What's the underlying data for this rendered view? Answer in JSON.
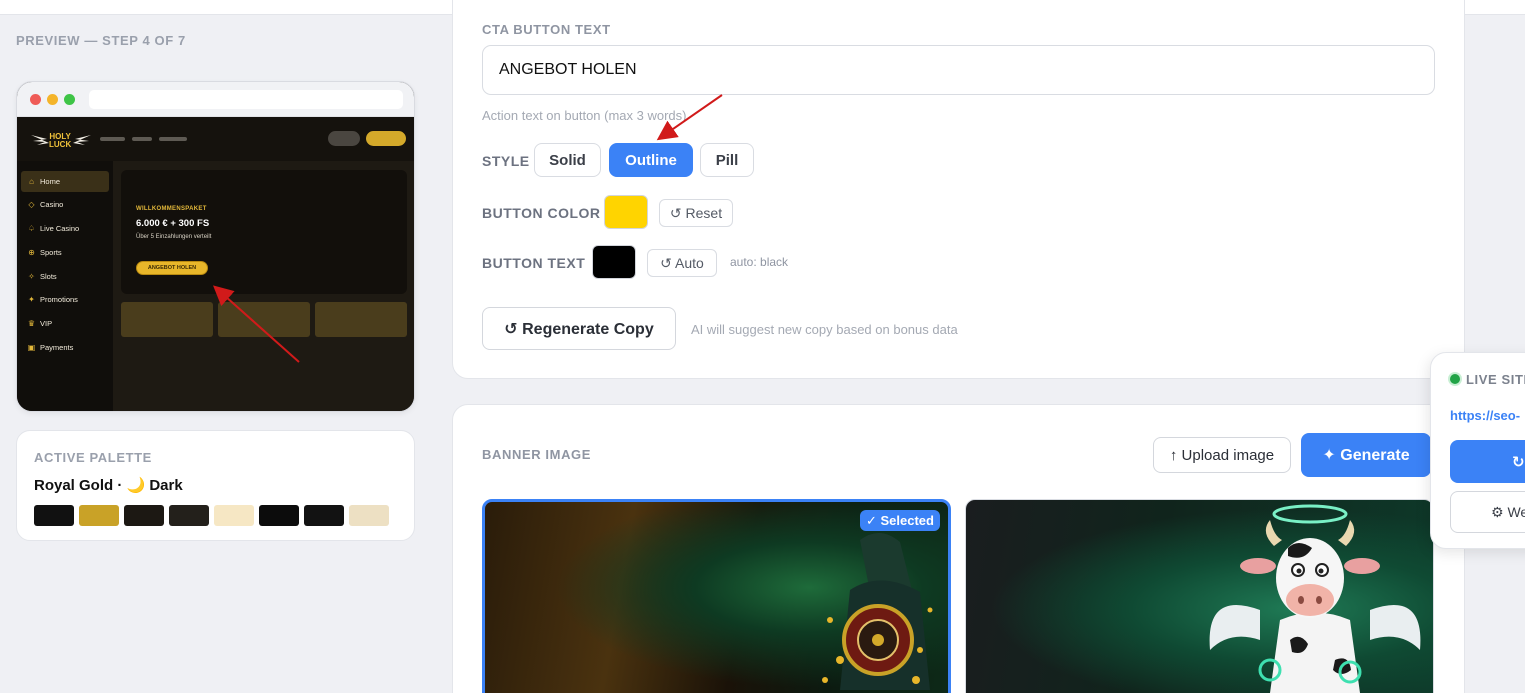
{
  "preview": {
    "label": "PREVIEW — STEP 4 OF 7",
    "mock": {
      "logo_line1": "HOLY",
      "logo_line2": "LUCK",
      "nav": [
        {
          "label": "Home",
          "icon": "home-icon",
          "glyph": "⌂"
        },
        {
          "label": "Casino",
          "icon": "diamond-icon",
          "glyph": "◇"
        },
        {
          "label": "Live Casino",
          "icon": "spade-icon",
          "glyph": "♤"
        },
        {
          "label": "Sports",
          "icon": "ball-icon",
          "glyph": "⊕"
        },
        {
          "label": "Slots",
          "icon": "sparkle-icon",
          "glyph": "✧"
        },
        {
          "label": "Promotions",
          "icon": "star-icon",
          "glyph": "✦"
        },
        {
          "label": "VIP",
          "icon": "crown-icon",
          "glyph": "♛"
        },
        {
          "label": "Payments",
          "icon": "card-icon",
          "glyph": "▣"
        }
      ],
      "hero_kicker": "WILLKOMMENSPAKET",
      "hero_title": "6.000 € + 300 FS",
      "hero_sub": "Über 5 Einzahlungen verteilt",
      "hero_cta": "ANGEBOT HOLEN"
    }
  },
  "palette": {
    "label": "ACTIVE PALETTE",
    "name": "Royal Gold · 🌙 Dark",
    "swatches": [
      "#111111",
      "#c9a227",
      "#1c1813",
      "#23201b",
      "#f6e7c4",
      "#0c0c0c",
      "#121212",
      "#ede0c3"
    ]
  },
  "cta": {
    "label": "CTA BUTTON TEXT",
    "value": "ANGEBOT HOLEN",
    "hint": "Action text on button (max 3 words)"
  },
  "style": {
    "label": "STYLE",
    "options": [
      "Solid",
      "Outline",
      "Pill"
    ],
    "selected": "Outline"
  },
  "button_color": {
    "label": "BUTTON COLOR",
    "value": "#ffd400",
    "reset_label": "↺ Reset"
  },
  "button_text": {
    "label": "BUTTON TEXT",
    "value": "#000000",
    "auto_label": "↺ Auto",
    "auto_hint": "auto: black"
  },
  "regenerate": {
    "label": "↺ Regenerate Copy",
    "hint": "AI will suggest new copy based on bonus data"
  },
  "banner": {
    "label": "BANNER IMAGE",
    "upload_label": "↑ Upload image",
    "generate_label": "✦ Generate",
    "selected_badge": "✓ Selected"
  },
  "live_site": {
    "label": "LIVE SITE",
    "url": "https://seo-",
    "btn1_label": "↻",
    "btn2_label": "⚙ We"
  },
  "colors": {
    "accent": "#3b82f6",
    "annotation": "#d11a1a"
  }
}
